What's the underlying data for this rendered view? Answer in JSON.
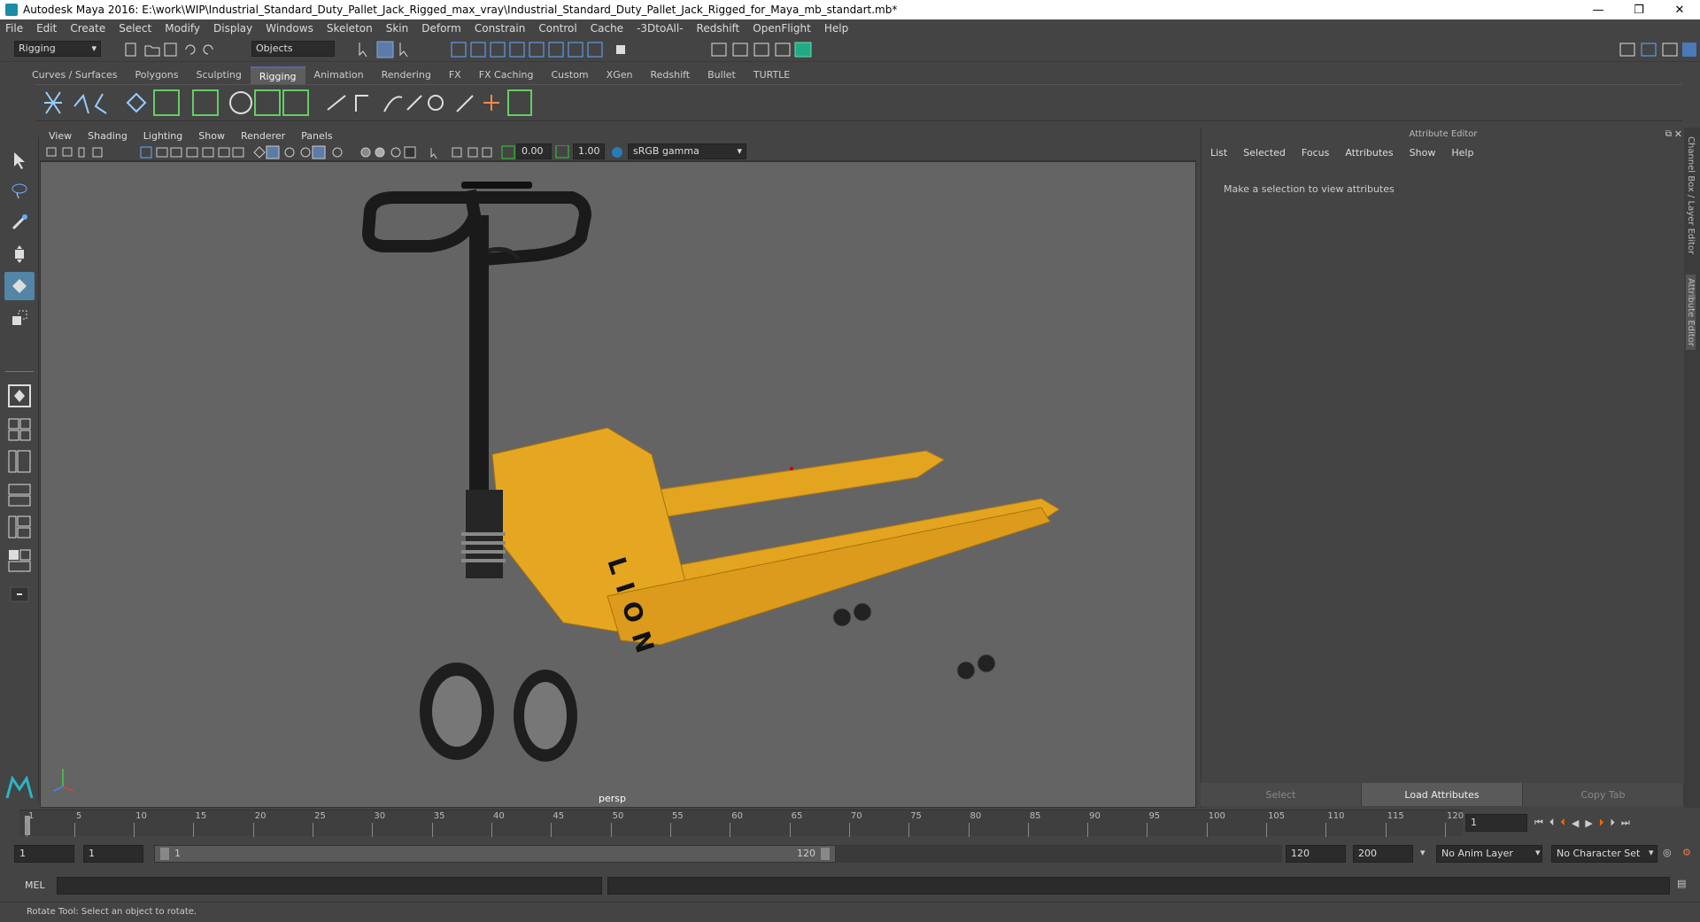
{
  "window": {
    "title": "Autodesk Maya 2016: E:\\work\\WIP\\Industrial_Standard_Duty_Pallet_Jack_Rigged_max_vray\\Industrial_Standard_Duty_Pallet_Jack_Rigged_for_Maya_mb_standart.mb*",
    "minimize": "—",
    "maximize": "❐",
    "close": "✕"
  },
  "menubar": [
    "File",
    "Edit",
    "Create",
    "Select",
    "Modify",
    "Display",
    "Windows",
    "Skeleton",
    "Skin",
    "Deform",
    "Constrain",
    "Control",
    "Cache",
    "-3DtoAll-",
    "Redshift",
    "OpenFlight",
    "Help"
  ],
  "statusline": {
    "menuset": "Rigging",
    "selection_mode": "Objects"
  },
  "shelf_tabs": [
    "Curves / Surfaces",
    "Polygons",
    "Sculpting",
    "Rigging",
    "Animation",
    "Rendering",
    "FX",
    "FX Caching",
    "Custom",
    "XGen",
    "Redshift",
    "Bullet",
    "TURTLE"
  ],
  "shelf_active": "Rigging",
  "panel_menu": [
    "View",
    "Shading",
    "Lighting",
    "Show",
    "Renderer",
    "Panels"
  ],
  "panel_tools": {
    "exposure": "0.00",
    "gamma": "1.00",
    "color_space": "sRGB gamma"
  },
  "viewport": {
    "camera_label": "persp",
    "model_text": "LION"
  },
  "attribute_editor": {
    "header": "Attribute Editor",
    "menu": [
      "List",
      "Selected",
      "Focus",
      "Attributes",
      "Show",
      "Help"
    ],
    "message": "Make a selection to view attributes",
    "buttons": [
      "Select",
      "Load Attributes",
      "Copy Tab"
    ]
  },
  "side_tabs": [
    "Channel Box / Layer Editor",
    "Attribute Editor"
  ],
  "timeline": {
    "ticks": [
      "1",
      "5",
      "10",
      "15",
      "20",
      "25",
      "30",
      "35",
      "40",
      "45",
      "50",
      "55",
      "60",
      "65",
      "70",
      "75",
      "80",
      "85",
      "90",
      "95",
      "100",
      "105",
      "110",
      "115",
      "120"
    ],
    "current_frame": "1"
  },
  "range": {
    "start": "1",
    "playback_start": "1",
    "slider_start": "1",
    "slider_end": "120",
    "playback_end": "120",
    "end": "200",
    "anim_layer": "No Anim Layer",
    "character_set": "No Character Set"
  },
  "cmdline": {
    "label": "MEL"
  },
  "helpline": "Rotate Tool: Select an object to rotate."
}
